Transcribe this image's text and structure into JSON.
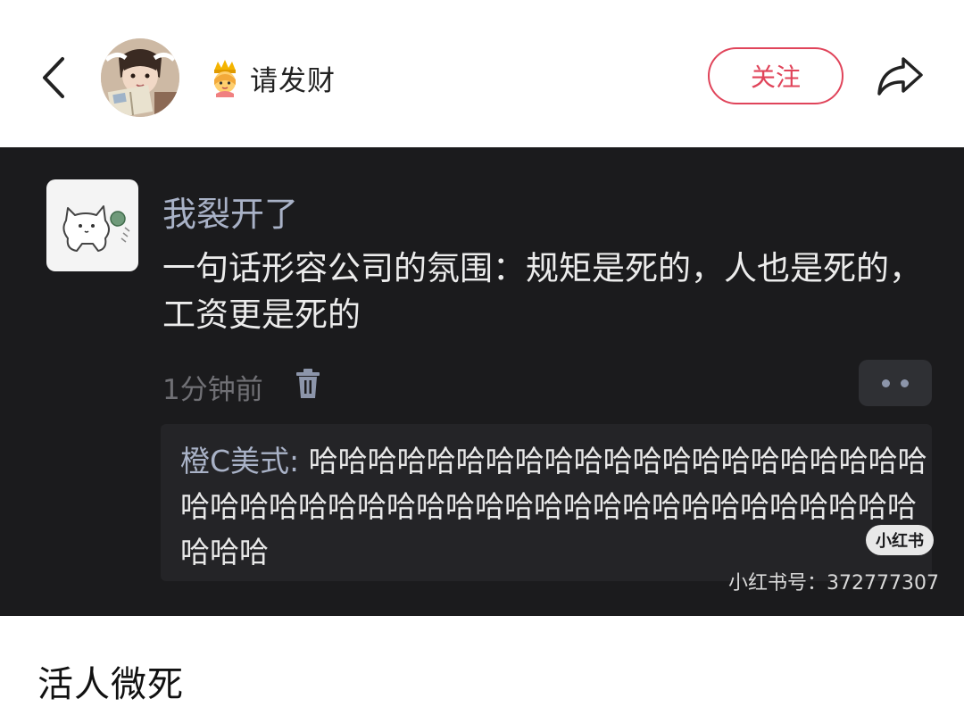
{
  "header": {
    "username": "请发财",
    "follow_label": "关注"
  },
  "post": {
    "author": "我裂开了",
    "content": "一句话形容公司的氛围：规矩是死的，人也是死的，工资更是死的",
    "time": "1分钟前",
    "reply": {
      "name": "橙C美式:",
      "text": "哈哈哈哈哈哈哈哈哈哈哈哈哈哈哈哈哈哈哈哈哈哈哈哈哈哈哈哈哈哈哈哈哈哈哈哈哈哈哈哈哈哈哈哈哈哈哈哈哈"
    },
    "watermark": {
      "badge": "小红书",
      "id_text": "小红书号：372777307"
    }
  },
  "caption": "活人微死",
  "colors": {
    "accent": "#e0445a",
    "dark_bg": "#1b1b1d",
    "username_blue": "#a9b2c7"
  },
  "icons": [
    "back-arrow-icon",
    "crown-emoji-icon",
    "share-icon",
    "trash-icon",
    "more-dots-icon",
    "cat-sticker-icon"
  ]
}
